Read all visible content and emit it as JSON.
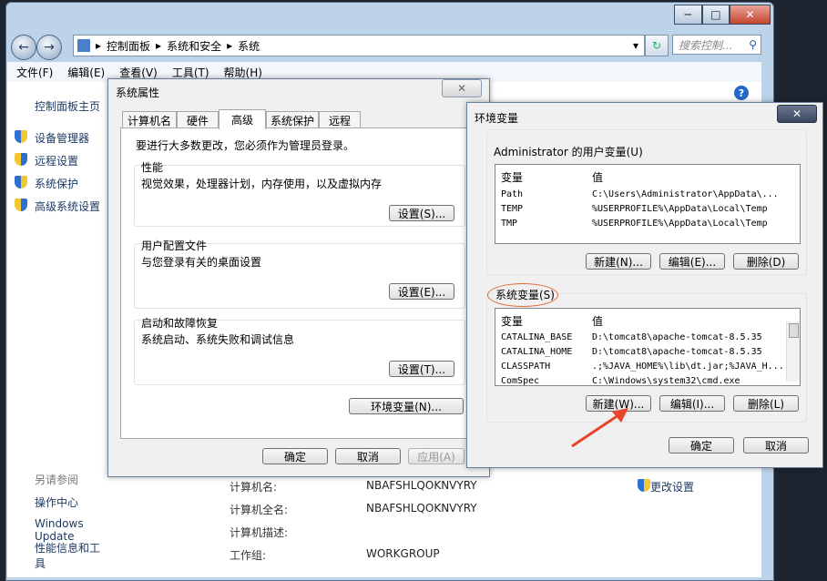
{
  "explorer": {
    "address_parts": [
      "控制面板",
      "系统和安全",
      "系统"
    ],
    "search_placeholder": "搜索控制...",
    "menu": [
      "文件(F)",
      "编辑(E)",
      "查看(V)",
      "工具(T)",
      "帮助(H)"
    ],
    "left_links": [
      "控制面板主页",
      "设备管理器",
      "远程设置",
      "系统保护",
      "高级系统设置"
    ],
    "see_also_title": "另请参阅",
    "see_also": [
      "操作中心",
      "Windows Update",
      "性能信息和工具"
    ],
    "info_rows": [
      {
        "label": "计算机名:",
        "value": "NBAFSHLQOKNVYRY"
      },
      {
        "label": "计算机全名:",
        "value": "NBAFSHLQOKNVYRY"
      },
      {
        "label": "计算机描述:",
        "value": ""
      },
      {
        "label": "工作组:",
        "value": "WORKGROUP"
      }
    ],
    "change_settings": "更改设置"
  },
  "sysprops": {
    "title": "系统属性",
    "tabs": [
      "计算机名",
      "硬件",
      "高级",
      "系统保护",
      "远程"
    ],
    "active_tab": "高级",
    "admin_note": "要进行大多数更改，您必须作为管理员登录。",
    "groups": [
      {
        "title": "性能",
        "desc": "视觉效果，处理器计划，内存使用，以及虚拟内存",
        "button": "设置(S)..."
      },
      {
        "title": "用户配置文件",
        "desc": "与您登录有关的桌面设置",
        "button": "设置(E)..."
      },
      {
        "title": "启动和故障恢复",
        "desc": "系统启动、系统失败和调试信息",
        "button": "设置(T)..."
      }
    ],
    "env_button": "环境变量(N)...",
    "ok": "确定",
    "cancel": "取消",
    "apply": "应用(A)"
  },
  "envvars": {
    "title": "环境变量",
    "user_group_title": "Administrator 的用户变量(U)",
    "col_var": "变量",
    "col_val": "值",
    "user_vars": [
      {
        "name": "Path",
        "value": "C:\\Users\\Administrator\\AppData\\..."
      },
      {
        "name": "TEMP",
        "value": "%USERPROFILE%\\AppData\\Local\\Temp"
      },
      {
        "name": "TMP",
        "value": "%USERPROFILE%\\AppData\\Local\\Temp"
      }
    ],
    "user_buttons": [
      "新建(N)...",
      "编辑(E)...",
      "删除(D)"
    ],
    "sys_group_title": "系统变量(S)",
    "sys_vars": [
      {
        "name": "CATALINA_BASE",
        "value": "D:\\tomcat8\\apache-tomcat-8.5.35"
      },
      {
        "name": "CATALINA_HOME",
        "value": "D:\\tomcat8\\apache-tomcat-8.5.35"
      },
      {
        "name": "CLASSPATH",
        "value": ".;%JAVA_HOME%\\lib\\dt.jar;%JAVA_H..."
      },
      {
        "name": "ComSpec",
        "value": "C:\\Windows\\system32\\cmd.exe"
      }
    ],
    "sys_buttons": [
      "新建(W)...",
      "编辑(I)...",
      "删除(L)"
    ],
    "ok": "确定",
    "cancel": "取消"
  },
  "colors": {
    "annotation": "#e8452c",
    "link": "#1f3a64"
  }
}
